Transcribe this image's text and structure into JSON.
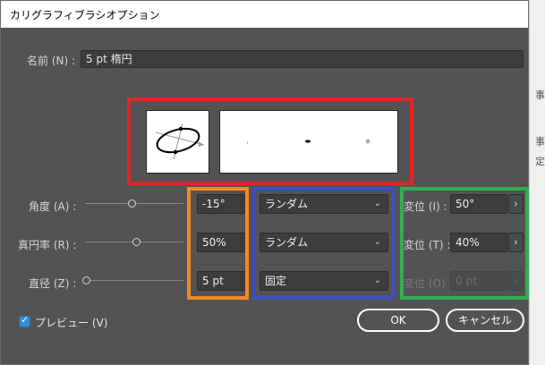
{
  "window": {
    "title": "カリグラフィブラシオプション"
  },
  "name_field": {
    "label": "名前 (N) :",
    "value": "5 pt  楕円"
  },
  "rows": [
    {
      "label": "角度 (A) :",
      "value": "-15°",
      "mode": "ランダム",
      "variation_label": "変位 (I) :",
      "variation_value": "50°",
      "stepper": "›",
      "variation_enabled": true
    },
    {
      "label": "真円率 (R) :",
      "value": "50%",
      "mode": "ランダム",
      "variation_label": "変位 (T) :",
      "variation_value": "40%",
      "stepper": "›",
      "variation_enabled": true
    },
    {
      "label": "直径 (Z) :",
      "value": "5 pt",
      "mode": "固定",
      "variation_label": "変位 (O) :",
      "variation_value": "0 pt",
      "stepper": "›",
      "variation_enabled": false
    }
  ],
  "preview_checkbox": {
    "label": "プレビュー (V)",
    "checked": true,
    "mark": "✓"
  },
  "buttons": {
    "ok": "OK",
    "cancel": "キャンセル"
  },
  "background_glyphs": [
    "事",
    "事",
    "定"
  ],
  "dropdown_chevron": "⌄",
  "colors": {
    "dialog_bg": "#535353",
    "highlight_red": "#e0262b",
    "highlight_orange": "#f08a24",
    "highlight_blue": "#3f4fbf",
    "highlight_green": "#2fae4f",
    "checkbox": "#2f8fd8"
  }
}
